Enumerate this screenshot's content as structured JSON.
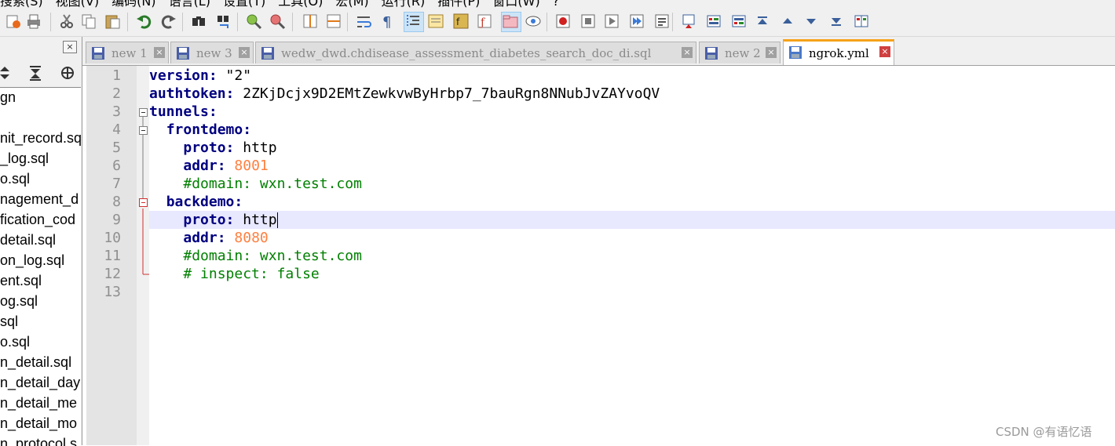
{
  "menubar": {
    "items": [
      "搜索(S)",
      "视图(V)",
      "编码(N)",
      "语言(L)",
      "设置(T)",
      "工具(O)",
      "宏(M)",
      "运行(R)",
      "插件(P)",
      "窗口(W)",
      "?"
    ]
  },
  "left_panel": {
    "close_glyph": "×",
    "files": [
      "gn",
      "",
      "nit_record.sql",
      "_log.sql",
      "o.sql",
      "nagement_d",
      "fication_cod",
      "detail.sql",
      "on_log.sql",
      "ent.sql",
      "og.sql",
      "sql",
      "o.sql",
      "n_detail.sql",
      "n_detail_day",
      "n_detail_me",
      "n_detail_mo",
      "n_protocol.s"
    ]
  },
  "tabs": [
    {
      "label": "new 1",
      "active": false
    },
    {
      "label": "new 3",
      "active": false
    },
    {
      "label": "wedw_dwd.chdisease_assessment_diabetes_search_doc_di.sql",
      "active": false
    },
    {
      "label": "new 2",
      "active": false
    },
    {
      "label": "ngrok.yml",
      "active": true
    }
  ],
  "tab_close_glyph": "×",
  "editor": {
    "line_numbers": [
      "1",
      "2",
      "3",
      "4",
      "5",
      "6",
      "7",
      "8",
      "9",
      "10",
      "11",
      "12",
      "13"
    ],
    "current_line": 9,
    "lines": [
      {
        "indent": "",
        "key": "version",
        "sep": ": ",
        "value": "\"2\"",
        "kind": "str"
      },
      {
        "indent": "",
        "key": "authtoken",
        "sep": ": ",
        "value": "2ZKjDcjx9D2EMtZewkvwByHrbp7_7bauRgn8NNubJvZAYvoQV",
        "kind": "str"
      },
      {
        "indent": "",
        "key": "tunnels",
        "sep": ":",
        "value": "",
        "kind": "str"
      },
      {
        "indent": "  ",
        "key": "frontdemo",
        "sep": ":",
        "value": "",
        "kind": "str"
      },
      {
        "indent": "    ",
        "key": "proto",
        "sep": ": ",
        "value": "http",
        "kind": "str"
      },
      {
        "indent": "    ",
        "key": "addr",
        "sep": ": ",
        "value": "8001",
        "kind": "num"
      },
      {
        "indent": "    ",
        "key": "",
        "sep": "",
        "value": "#domain: wxn.test.com",
        "kind": "cmt"
      },
      {
        "indent": "  ",
        "key": "backdemo",
        "sep": ":",
        "value": "",
        "kind": "str"
      },
      {
        "indent": "    ",
        "key": "proto",
        "sep": ": ",
        "value": "http",
        "kind": "str"
      },
      {
        "indent": "    ",
        "key": "addr",
        "sep": ": ",
        "value": "8080",
        "kind": "num"
      },
      {
        "indent": "    ",
        "key": "",
        "sep": "",
        "value": "#domain: wxn.test.com",
        "kind": "cmt"
      },
      {
        "indent": "    ",
        "key": "",
        "sep": "",
        "value": "# inspect: false",
        "kind": "cmt"
      },
      {
        "indent": "",
        "key": "",
        "sep": "",
        "value": "",
        "kind": "str"
      }
    ]
  },
  "watermark": "CSDN @有语忆语",
  "colors": {
    "keyword": "#000080",
    "number": "#ff8040",
    "comment": "#008000",
    "active_tab_accent": "#f6a21a",
    "current_line": "#e8e8ff"
  },
  "toolbar_icons": [
    "open-file-icon",
    "print-icon",
    "cut-icon",
    "copy-icon",
    "paste-icon",
    "undo-icon",
    "redo-icon",
    "find-icon",
    "replace-icon",
    "zoom-in-icon",
    "zoom-out-icon",
    "sync-vertical-icon",
    "sync-horizontal-icon",
    "word-wrap-icon",
    "show-all-chars-icon",
    "indent-guide-icon",
    "doc-map-icon",
    "function-list-icon",
    "doc-list-icon",
    "folder-workspace-icon",
    "monitoring-icon",
    "record-macro-icon",
    "stop-record-icon",
    "play-macro-icon",
    "run-macro-multiple-icon",
    "save-macro-icon",
    "compare-icon",
    "compare-prev-icon",
    "compare-next-icon",
    "nav-first-icon",
    "nav-up-icon",
    "nav-down-icon",
    "nav-last-icon",
    "compare-options-icon"
  ]
}
